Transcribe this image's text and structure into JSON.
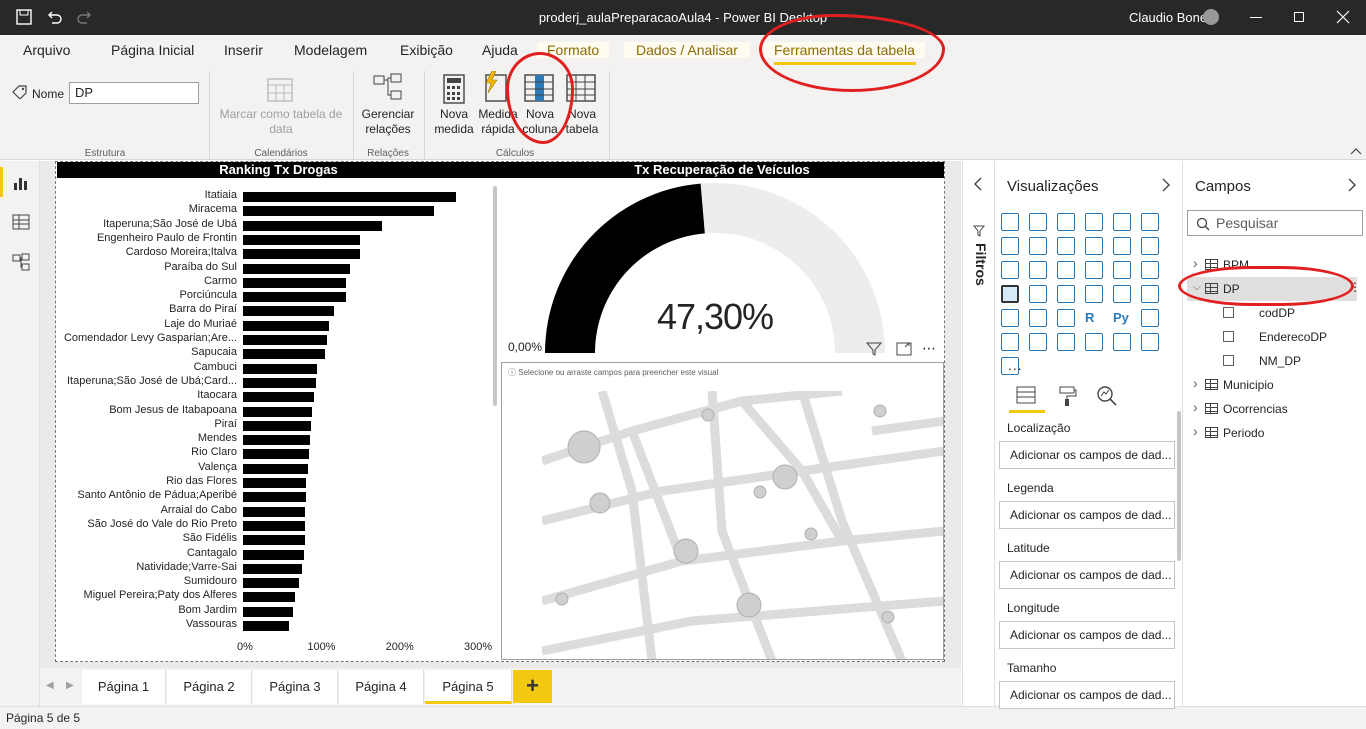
{
  "window": {
    "title": "proderj_aulaPreparacaoAula4 - Power BI Desktop",
    "user": "Claudio Bonel"
  },
  "ribbon_tabs": [
    {
      "label": "Arquivo"
    },
    {
      "label": "Página Inicial"
    },
    {
      "label": "Inserir"
    },
    {
      "label": "Modelagem"
    },
    {
      "label": "Exibição"
    },
    {
      "label": "Ajuda"
    },
    {
      "label": "Formato"
    },
    {
      "label": "Dados / Analisar"
    },
    {
      "label": "Ferramentas da tabela"
    }
  ],
  "ribbon": {
    "name_label": "Nome",
    "name_value": "DP",
    "mark_date_table": "Marcar como tabela de data",
    "manage_relations": "Gerenciar relações",
    "new_measure": "Nova medida",
    "quick_measure": "Medida rápida",
    "new_column": "Nova coluna",
    "new_table": "Nova tabela",
    "groups": {
      "estrutura": "Estrutura",
      "calendarios": "Calendários",
      "relacoes": "Relações",
      "calculos": "Cálculos"
    }
  },
  "visuals": {
    "bar_title": "Ranking Tx Drogas",
    "gauge_title": "Tx Recuperação de Veículos",
    "gauge_value": "47,30%",
    "gauge_min": "0,00%",
    "map_hint": "Selecione ou arraste campos para preencher este visual"
  },
  "chart_data": {
    "type": "bar",
    "title": "Ranking Tx Drogas",
    "orientation": "horizontal",
    "categories": [
      "Itatiaia",
      "Miracema",
      "Itaperuna;São José de Ubá",
      "Engenheiro Paulo de Frontin",
      "Cardoso Moreira;Italva",
      "Paraíba do Sul",
      "Carmo",
      "Porciúncula",
      "Barra do Piraí",
      "Laje do Muriaé",
      "Comendador Levy Gasparian;Are...",
      "Sapucaia",
      "Cambuci",
      "Itaperuna;São José de Ubá;Card...",
      "Itaocara",
      "Bom Jesus de Itabapoana",
      "Piraí",
      "Mendes",
      "Rio Claro",
      "Valença",
      "Rio das Flores",
      "Santo Antônio de Pádua;Aperibé",
      "Arraial do Cabo",
      "São José do Vale do Rio Preto",
      "São Fidélis",
      "Cantagalo",
      "Natividade;Varre-Sai",
      "Sumidouro",
      "Miguel Pereira;Paty dos Alferes",
      "Bom Jardim",
      "Vassouras"
    ],
    "values": [
      272,
      244,
      177,
      149,
      149,
      136,
      132,
      131,
      116,
      110,
      107,
      105,
      95,
      93,
      90,
      88,
      87,
      85,
      84,
      83,
      80,
      80,
      79,
      79,
      79,
      78,
      75,
      71,
      66,
      64,
      59
    ],
    "xticks": [
      "0%",
      "100%",
      "200%",
      "300%"
    ],
    "xlim": [
      0,
      300
    ],
    "unit": "%"
  },
  "page_tabs": [
    "Página 1",
    "Página 2",
    "Página 3",
    "Página 4",
    "Página 5"
  ],
  "add_page": "+",
  "status": "Página 5 de 5",
  "filters_label": "Filtros",
  "viz_pane": {
    "title": "Visualizações",
    "wells": [
      {
        "label": "Localização",
        "placeholder": "Adicionar os campos de dad..."
      },
      {
        "label": "Legenda",
        "placeholder": "Adicionar os campos de dad..."
      },
      {
        "label": "Latitude",
        "placeholder": "Adicionar os campos de dad..."
      },
      {
        "label": "Longitude",
        "placeholder": "Adicionar os campos de dad..."
      },
      {
        "label": "Tamanho",
        "placeholder": "Adicionar os campos de dad..."
      }
    ],
    "icon_more": "..."
  },
  "fields_pane": {
    "title": "Campos",
    "search_placeholder": "Pesquisar",
    "tables": [
      {
        "name": "BPM",
        "expanded": false
      },
      {
        "name": "DP",
        "expanded": true,
        "fields": [
          "codDP",
          "EnderecoDP",
          "NM_DP"
        ]
      },
      {
        "name": "Municipio",
        "expanded": false
      },
      {
        "name": "Ocorrencias",
        "expanded": false
      },
      {
        "name": "Periodo",
        "expanded": false
      }
    ]
  },
  "colors": {
    "accent": "#f2c811",
    "annotation": "#e02020",
    "titlebar": "#282828"
  }
}
